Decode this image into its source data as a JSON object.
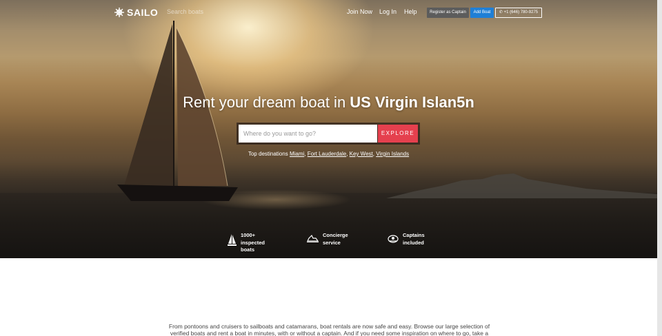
{
  "nav": {
    "logo_text": "SAILO",
    "search_link": "Search boats",
    "join_label": "Join Now",
    "login_label": "Log In",
    "help_label": "Help",
    "register_captain_label": "Register as Captain",
    "add_boat_label": "Add Boat",
    "phone_label": "+1 (646) 780-9275"
  },
  "hero": {
    "headline_prefix": "Rent your dream boat in ",
    "headline_place": "US Virgin Islan5n",
    "search_placeholder": "Where do you want to go?",
    "explore_label": "EXPLORE",
    "top_destinations_label": "Top destinations",
    "destinations": [
      "Miami",
      "Fort Lauderdale",
      "Key West",
      "Virgin Islands"
    ]
  },
  "features": [
    {
      "icon": "sailboat-icon",
      "line1": "1000+",
      "line2": "inspected",
      "line3": "boats"
    },
    {
      "icon": "yacht-icon",
      "line1": "Concierge",
      "line2": "service"
    },
    {
      "icon": "captain-hat-icon",
      "line1": "Captains",
      "line2": "included"
    }
  ],
  "intro": {
    "text": "From pontoons and cruisers to sailboats and catamarans, boat rentals are now safe and easy. Browse our large selection of verified boats and rent a boat in minutes, with or without a captain. And if you need some inspiration on where to go, take a"
  },
  "colors": {
    "explore_red": "#e5404e",
    "add_boat_blue": "#1f7fd6",
    "captain_gray": "#5c5c5c"
  }
}
